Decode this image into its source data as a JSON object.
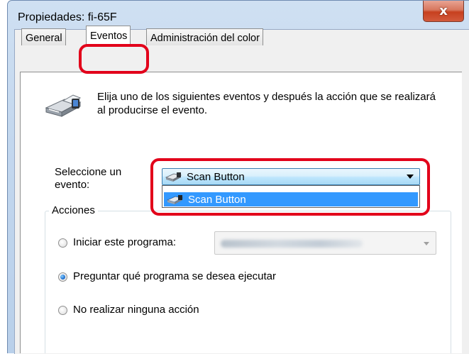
{
  "window": {
    "title": "Propiedades: fi-65F",
    "close_glyph": "x"
  },
  "tabs": [
    {
      "label": "General",
      "selected": false
    },
    {
      "label": "Eventos",
      "selected": true
    },
    {
      "label": "Administración del color",
      "selected": false
    }
  ],
  "events_tab": {
    "intro_text": "Elija uno de los siguientes eventos y después la acción que se realizará al producirse el evento.",
    "select_event_label": "Seleccione un evento:",
    "selected_event": "Scan Button",
    "dropdown_options": [
      "Scan Button"
    ],
    "actions_group_label": "Acciones",
    "actions": [
      {
        "label": "Iniciar este programa:",
        "checked": false
      },
      {
        "label": "Preguntar qué programa se desea ejecutar",
        "checked": true
      },
      {
        "label": "No realizar ninguna acción",
        "checked": false
      }
    ]
  },
  "colors": {
    "highlight": "#e2001a",
    "selection": "#3399ff"
  }
}
